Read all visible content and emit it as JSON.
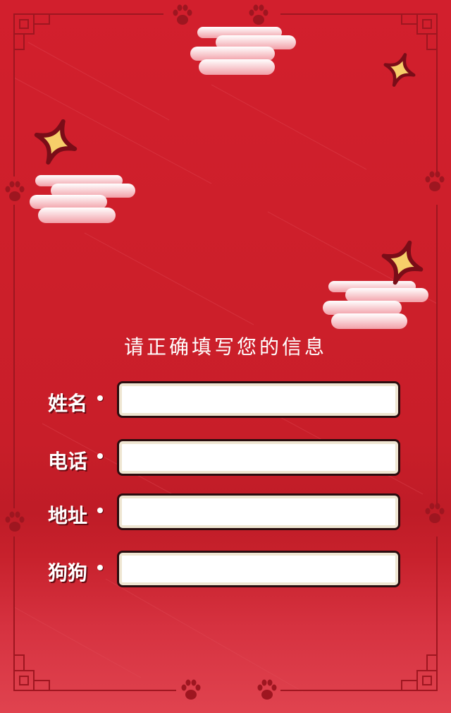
{
  "form": {
    "title": "请正确填写您的信息",
    "fields": [
      {
        "label": "姓名",
        "value": "",
        "placeholder": ""
      },
      {
        "label": "电话",
        "value": "",
        "placeholder": ""
      },
      {
        "label": "地址",
        "value": "",
        "placeholder": ""
      },
      {
        "label": "狗狗",
        "value": "",
        "placeholder": ""
      }
    ]
  },
  "colors": {
    "background": "#cc1f2a",
    "frame_line": "#9e1620",
    "sparkle_fill": "#f7cf6a",
    "sparkle_outline": "#7a0d18",
    "cloud_top": "#ffffff",
    "cloud_bottom": "#f2a0a8",
    "input_border": "#2a0d0f",
    "input_inner": "#efe6d2"
  },
  "icons": [
    "cloud-icon",
    "sparkle-icon",
    "paw-print-icon"
  ]
}
